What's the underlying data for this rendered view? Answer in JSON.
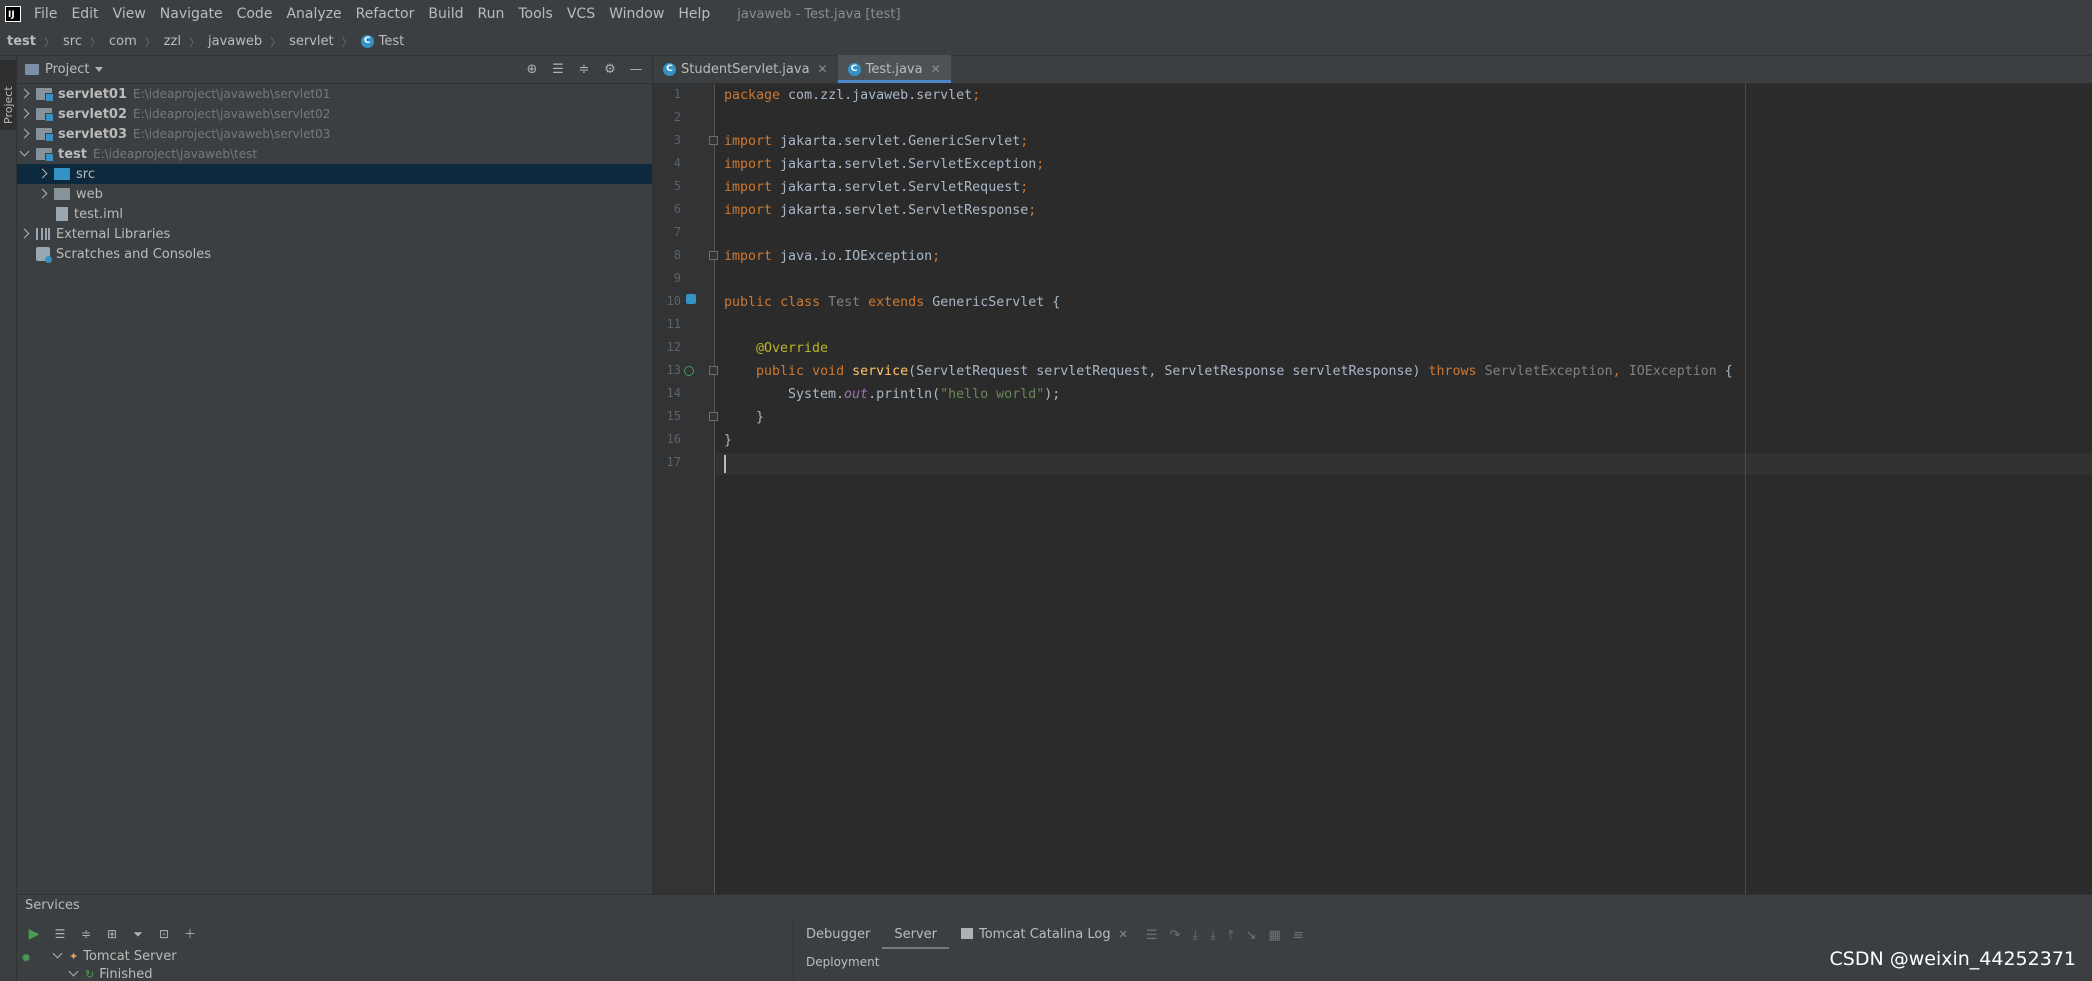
{
  "menu": {
    "items": [
      "File",
      "Edit",
      "View",
      "Navigate",
      "Code",
      "Analyze",
      "Refactor",
      "Build",
      "Run",
      "Tools",
      "VCS",
      "Window",
      "Help"
    ],
    "window_title": "javaweb - Test.java [test]"
  },
  "breadcrumb": {
    "items": [
      "test",
      "src",
      "com",
      "zzl",
      "javaweb",
      "servlet",
      "Test"
    ]
  },
  "left_stripe": {
    "project_label": "Project"
  },
  "project_panel": {
    "title": "Project",
    "tree": [
      {
        "name": "servlet01",
        "path": "E:\\ideaproject\\javaweb\\servlet01"
      },
      {
        "name": "servlet02",
        "path": "E:\\ideaproject\\javaweb\\servlet02"
      },
      {
        "name": "servlet03",
        "path": "E:\\ideaproject\\javaweb\\servlet03"
      },
      {
        "name": "test",
        "path": "E:\\ideaproject\\javaweb\\test"
      },
      {
        "name": "src",
        "path": ""
      },
      {
        "name": "web",
        "path": ""
      },
      {
        "name": "test.iml",
        "path": ""
      },
      {
        "name": "External Libraries",
        "path": ""
      },
      {
        "name": "Scratches and Consoles",
        "path": ""
      }
    ]
  },
  "editor": {
    "tabs": [
      {
        "label": "StudentServlet.java",
        "active": false
      },
      {
        "label": "Test.java",
        "active": true
      }
    ],
    "line_numbers": [
      "1",
      "2",
      "3",
      "4",
      "5",
      "6",
      "7",
      "8",
      "9",
      "10",
      "11",
      "12",
      "13",
      "14",
      "15",
      "16",
      "17"
    ],
    "code": {
      "l1_kw": "package",
      "l1_rest": " com.zzl.javaweb.servlet",
      "l1_semi": ";",
      "l3_kw": "import",
      "l3_rest": " jakarta.servlet.GenericServlet",
      "semi": ";",
      "l4_kw": "import",
      "l4_rest": " jakarta.servlet.ServletException",
      "l5_kw": "import",
      "l5_rest": " jakarta.servlet.ServletRequest",
      "l6_kw": "import",
      "l6_rest": " jakarta.servlet.ServletResponse",
      "l8_kw": "import",
      "l8_rest": " java.io.IOException",
      "l10_kw1": "public",
      "l10_kw2": "class",
      "l10_cls": "Test",
      "l10_kw3": "extends",
      "l10_rest": " GenericServlet {",
      "l12_ann": "@Override",
      "l13_kw1": "public",
      "l13_kw2": "void",
      "l13_fn": "service",
      "l13_params": "(ServletRequest servletRequest, ServletResponse servletResponse) ",
      "l13_throws": "throws",
      "l13_ex1": "ServletException",
      "l13_comma": ", ",
      "l13_ex2": "IOException",
      "l13_end": " {",
      "l14_a": "System.",
      "l14_field": "out",
      "l14_b": ".println(",
      "l14_str": "\"hello world\"",
      "l14_c": ");",
      "l15": "}",
      "l16": "}"
    }
  },
  "services": {
    "title": "Services",
    "tree": [
      "Tomcat Server",
      "Finished"
    ],
    "tabs": [
      {
        "label": "Debugger"
      },
      {
        "label": "Server"
      },
      {
        "label": "Tomcat Catalina Log"
      }
    ],
    "deployment_label": "Deployment"
  },
  "watermark": "CSDN @weixin_44252371",
  "colors": {
    "keyword": "#cc7832",
    "annotation": "#bbb529",
    "string": "#6a8759",
    "method": "#ffc66d",
    "field": "#9876aa",
    "selection": "#0d293e",
    "accent": "#4a88c7"
  }
}
